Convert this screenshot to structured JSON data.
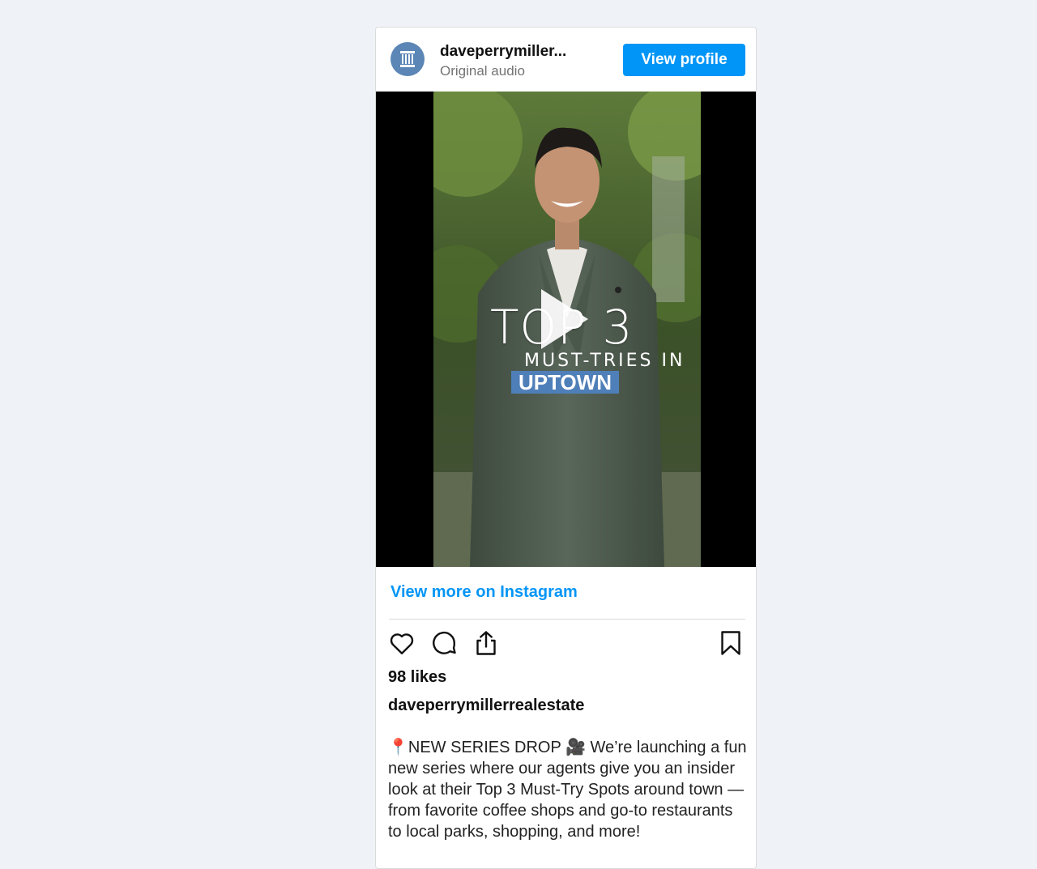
{
  "post": {
    "username": "daveperrymiller...",
    "audio": "Original audio",
    "view_profile_label": "View profile",
    "video_overlay": {
      "title": "TOP 3",
      "subtitle": "MUST-TRIES IN",
      "tag": "UPTOWN"
    },
    "view_more_label": "View more on Instagram",
    "likes": "98 likes",
    "caption_username": "daveperrymillerrealestate",
    "caption": "📍NEW SERIES DROP 🎥 We’re launching a fun new series where our agents give you an insider look at their Top 3 Must-Try Spots around town — from favorite coffee shops and go-to restaurants to local parks, shopping, and more!"
  },
  "icons": {
    "avatar": "building-logo-icon",
    "play": "play-icon",
    "like": "heart-icon",
    "comment": "comment-icon",
    "share": "share-icon",
    "save": "bookmark-icon"
  },
  "colors": {
    "accent": "#0095f6",
    "tag_background": "#4f7fb8",
    "avatar_background": "#5b86b5"
  }
}
